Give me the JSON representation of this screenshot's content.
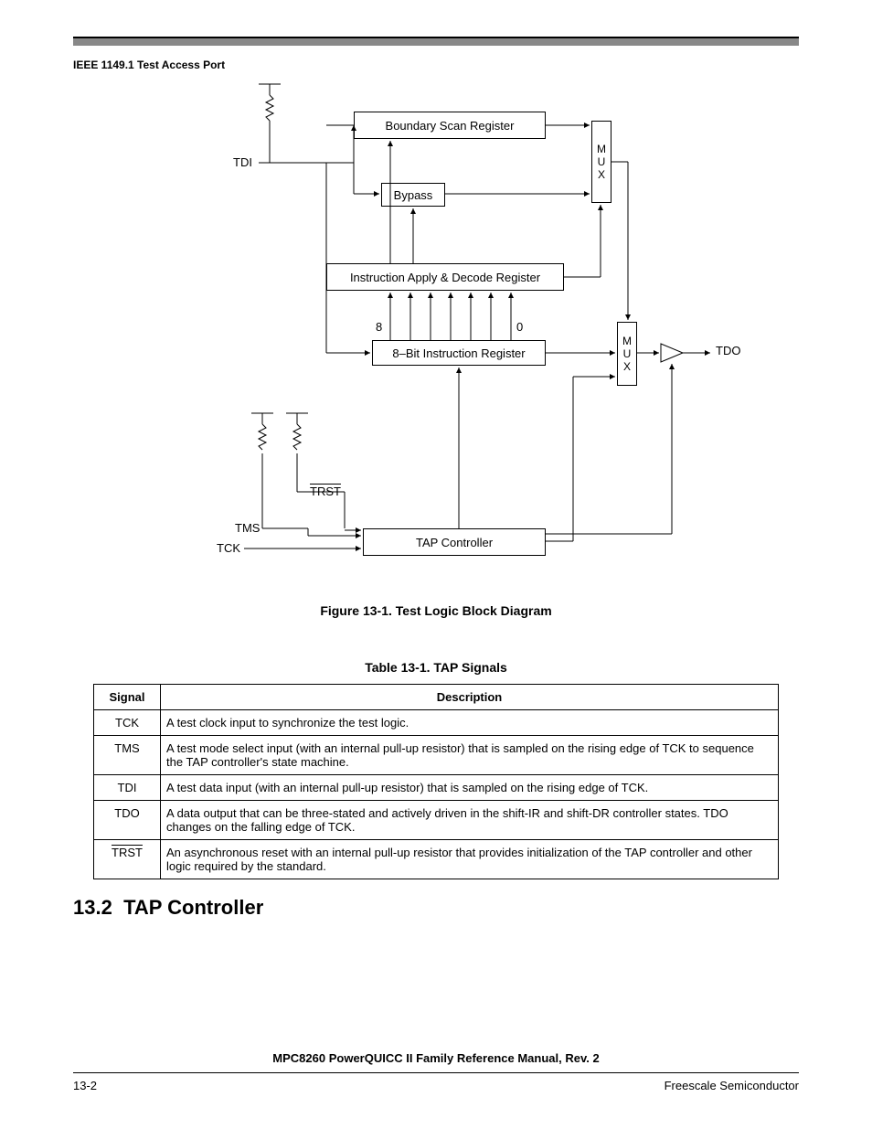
{
  "header": {
    "title": "IEEE 1149.1 Test Access Port"
  },
  "diagram": {
    "labels": {
      "tdi": "TDI",
      "bsr": "Boundary Scan Register",
      "bypass": "Bypass",
      "iadr": "Instruction Apply & Decode Register",
      "bit8": "8",
      "bit0": "0",
      "ir": "8–Bit Instruction Register",
      "trst": "TRST",
      "tms": "TMS",
      "tck": "TCK",
      "tapc": "TAP Controller",
      "tdo": "TDO",
      "mux": "M\nU\nX"
    },
    "caption": "Figure 13-1. Test Logic Block Diagram"
  },
  "table": {
    "caption": "Table 13-1. TAP Signals",
    "headers": {
      "signal": "Signal",
      "desc": "Description"
    },
    "rows": [
      {
        "signal": "TCK",
        "desc": "A test clock input to synchronize the test logic."
      },
      {
        "signal": "TMS",
        "desc": "A test mode select input (with an internal pull-up resistor) that is sampled on the rising edge of TCK to sequence the TAP controller's state machine."
      },
      {
        "signal": "TDI",
        "desc": "A test data input (with an internal pull-up resistor) that is sampled on the rising edge of TCK."
      },
      {
        "signal": "TDO",
        "desc": "A data output that can be three-stated and actively driven in the shift-IR and shift-DR controller states. TDO changes on the falling edge of TCK."
      },
      {
        "signal": "TRST",
        "desc": "An asynchronous reset with an internal pull-up resistor that provides initialization of the TAP controller and other logic required by the standard."
      }
    ]
  },
  "section": {
    "number": "13.2",
    "title": "TAP Controller"
  },
  "footer": {
    "manual": "MPC8260 PowerQUICC II Family Reference Manual, Rev. 2",
    "page": "13-2",
    "company": "Freescale Semiconductor"
  }
}
